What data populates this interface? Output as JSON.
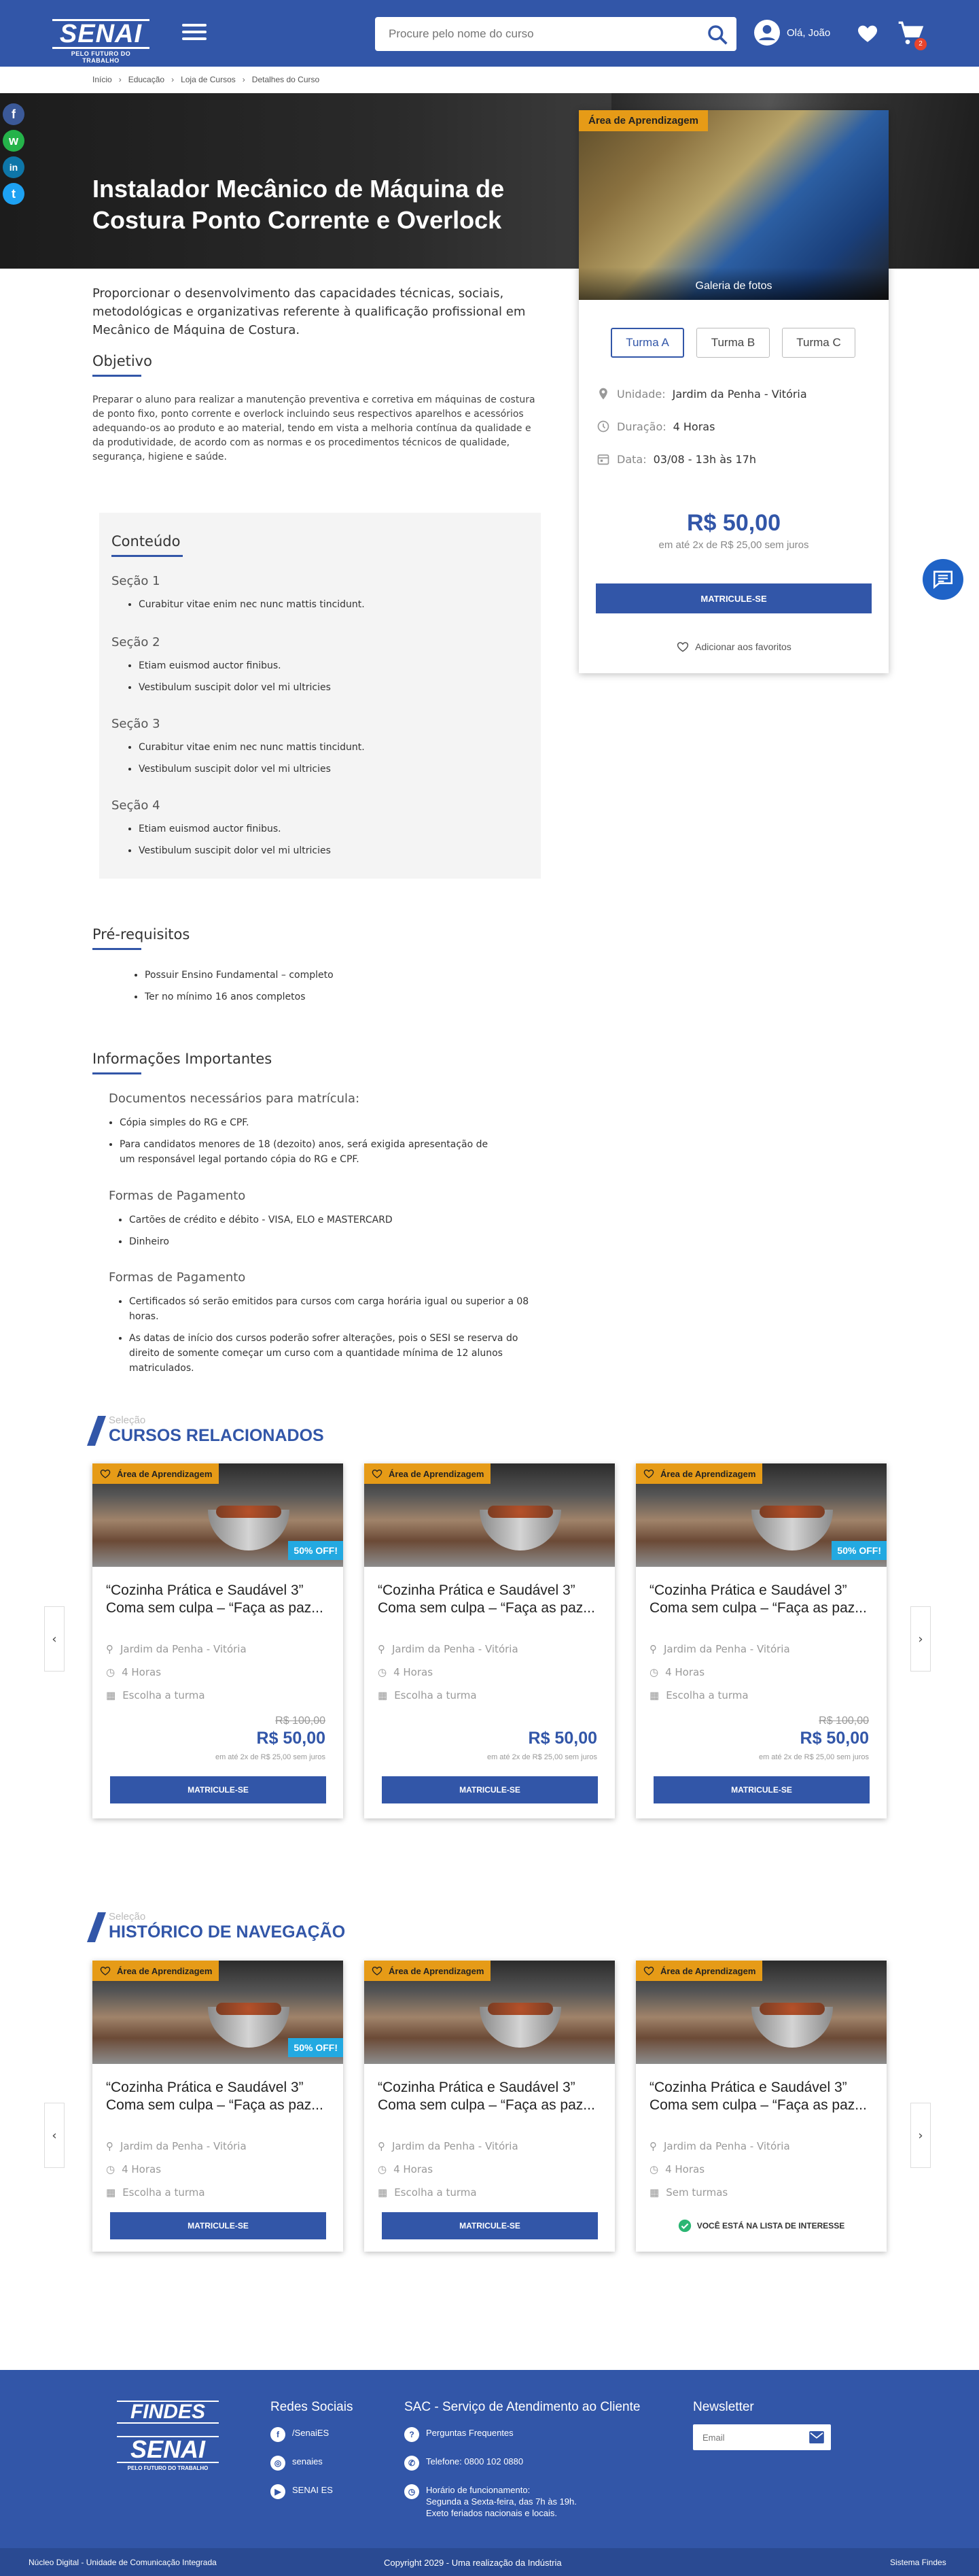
{
  "header": {
    "logo_main": "SENAI",
    "logo_sub": "PELO FUTURO DO TRABALHO",
    "search_placeholder": "Procure pelo nome do curso",
    "user_greeting": "Olá, João",
    "cart_count": "2"
  },
  "breadcrumb": [
    "Início",
    "Educação",
    "Loja de Cursos",
    "Detalhes do Curso"
  ],
  "social": [
    "f",
    "w",
    "in",
    "t"
  ],
  "course": {
    "title": "Instalador Mecânico de Máquina de Costura Ponto Corrente e Overlock",
    "description": "Proporcionar o desenvolvimento das capacidades técnicas, sociais, metodológicas e organizativas referente à qualificação profissional em Mecânico de Máquina de Costura.",
    "objetivo_title": "Objetivo",
    "objetivo_text": "Preparar o aluno para realizar a manutenção preventiva e corretiva em máquinas de costura de ponto fixo, ponto corrente e overlock incluindo seus respectivos aparelhos e acessórios adequando-os ao produto e ao material, tendo em vista a melhoria contínua da qualidade e da produtividade, de acordo com as normas e os procedimentos técnicos de qualidade, segurança, higiene e saúde."
  },
  "sidecard": {
    "tag": "Área de Aprendizagem",
    "gallery": "Galeria de fotos",
    "turmas": [
      "Turma A",
      "Turma B",
      "Turma C"
    ],
    "unidade_label": "Unidade:",
    "unidade_value": "Jardim da Penha - Vitória",
    "duracao_label": "Duração:",
    "duracao_value": "4 Horas",
    "data_label": "Data:",
    "data_value": "03/08 - 13h às 17h",
    "price": "R$ 50,00",
    "installments": "em até 2x de R$ 25,00 sem juros",
    "enroll": "MATRICULE-SE",
    "favorite": "Adicionar aos favoritos"
  },
  "conteudo": {
    "title": "Conteúdo",
    "sections": [
      {
        "name": "Seção 1",
        "items": [
          "Curabitur vitae enim nec nunc mattis tincidunt."
        ]
      },
      {
        "name": "Seção 2",
        "items": [
          "Etiam euismod auctor finibus.",
          "Vestibulum suscipit dolor vel mi ultricies"
        ]
      },
      {
        "name": "Seção 3",
        "items": [
          "Curabitur vitae enim nec nunc mattis tincidunt.",
          "Vestibulum suscipit dolor vel mi ultricies"
        ]
      },
      {
        "name": "Seção 4",
        "items": [
          "Etiam euismod auctor finibus.",
          "Vestibulum suscipit dolor vel mi ultricies"
        ]
      }
    ]
  },
  "prereq": {
    "title": "Pré-requisitos",
    "items": [
      "Possuir Ensino Fundamental – completo",
      "Ter no mínimo 16 anos completos"
    ]
  },
  "info": {
    "title": "Informações Importantes",
    "groups": [
      {
        "title": "Documentos necessários para matrícula:",
        "items": [
          "Cópia simples do RG e CPF.",
          "Para candidatos menores de 18 (dezoito) anos, será exigida apresentação de um responsável legal portando cópia do RG e CPF."
        ]
      },
      {
        "title": "Formas de Pagamento",
        "items": [
          "Cartões de crédito e débito - VISA, ELO e MASTERCARD",
          "Dinheiro"
        ]
      },
      {
        "title": "Formas de Pagamento",
        "items": [
          "Certificados só serão emitidos para cursos com carga horária igual ou superior a 08 horas.",
          "As datas de início dos cursos poderão sofrer alterações, pois o SESI se reserva do direito de somente começar um curso com a quantidade mínima de 12 alunos matriculados."
        ]
      }
    ]
  },
  "related": {
    "pre": "Seleção",
    "title": "CURSOS RELACIONADOS",
    "cards": [
      {
        "tag": "Área de Aprendizagem",
        "off": "50% OFF!",
        "title": "“Cozinha Prática e Saudável 3” Coma sem culpa – “Faça as paz...",
        "local": "Jardim da Penha - Vitória",
        "hours": "4 Horas",
        "turma": "Escolha a turma",
        "old": "R$ 100,00",
        "price": "R$ 50,00",
        "inst": "em até 2x de R$ 25,00 sem juros",
        "btn": "MATRICULE-SE"
      },
      {
        "tag": "Área de Aprendizagem",
        "off": "",
        "title": "“Cozinha Prática e Saudável 3” Coma sem culpa – “Faça as paz...",
        "local": "Jardim da Penha - Vitória",
        "hours": "4 Horas",
        "turma": "Escolha a turma",
        "old": "",
        "price": "R$ 50,00",
        "inst": "em até 2x de R$ 25,00 sem juros",
        "btn": "MATRICULE-SE"
      },
      {
        "tag": "Área de Aprendizagem",
        "off": "50% OFF!",
        "title": "“Cozinha Prática e Saudável 3” Coma sem culpa – “Faça as paz...",
        "local": "Jardim da Penha - Vitória",
        "hours": "4 Horas",
        "turma": "Escolha a turma",
        "old": "R$ 100,00",
        "price": "R$ 50,00",
        "inst": "em até 2x de R$ 25,00 sem juros",
        "btn": "MATRICULE-SE"
      }
    ]
  },
  "history": {
    "pre": "Seleção",
    "title": "HISTÓRICO DE NAVEGAÇÃO",
    "cards": [
      {
        "tag": "Área de Aprendizagem",
        "off": "50% OFF!",
        "title": "“Cozinha Prática e Saudável 3” Coma sem culpa – “Faça as paz...",
        "local": "Jardim da Penha - Vitória",
        "hours": "4 Horas",
        "turma": "Escolha a turma",
        "btn": "MATRICULE-SE"
      },
      {
        "tag": "Área de Aprendizagem",
        "off": "",
        "title": "“Cozinha Prática e Saudável 3” Coma sem culpa – “Faça as paz...",
        "local": "Jardim da Penha - Vitória",
        "hours": "4 Horas",
        "turma": "Escolha a turma",
        "btn": "MATRICULE-SE"
      },
      {
        "tag": "Área de Aprendizagem",
        "off": "",
        "title": "“Cozinha Prática e Saudável 3” Coma sem culpa – “Faça as paz...",
        "local": "Jardim da Penha - Vitória",
        "hours": "4 Horas",
        "turma": "Sem turmas",
        "interest": "VOCÊ ESTÁ NA LISTA DE INTERESSE"
      }
    ]
  },
  "footer": {
    "findes": "FINDES",
    "senai": "SENAI",
    "senai_sub": "PELO FUTURO DO TRABALHO",
    "redes_title": "Redes Sociais",
    "redes": [
      "/SenaiES",
      "senaies",
      "SENAI ES"
    ],
    "sac_title": "SAC - Serviço de Atendimento ao Cliente",
    "sac": [
      "Perguntas Frequentes",
      "Telefone: 0800 102 0880",
      "Horário de funcionamento:\nSegunda a Sexta-feira, das 7h às 19h.\nExeto feriados nacionais e locais."
    ],
    "news_title": "Newsletter",
    "news_placeholder": "Email",
    "bottom_left": "Núcleo Digital - Unidade de Comunicação Integrada",
    "bottom_center": "Copyright 2029 - Uma realização da Indústria",
    "bottom_right": "Sistema Findes"
  },
  "colors": {
    "primary": "#3256a8",
    "tag": "#e69b17",
    "off": "#23a9e1",
    "chat": "#1f63c7"
  }
}
